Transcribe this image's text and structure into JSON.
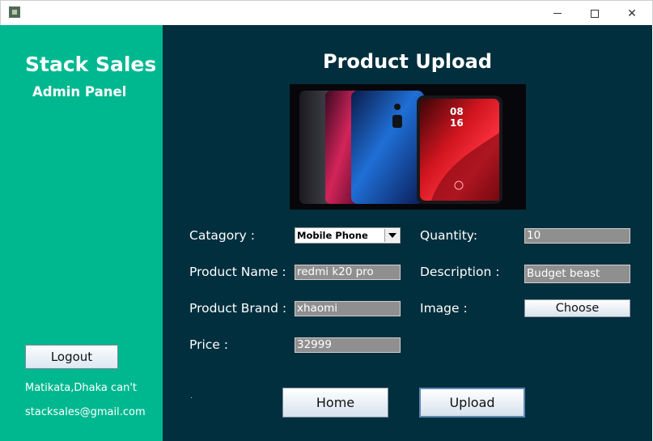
{
  "sidebar": {
    "brand": "Stack Sales",
    "subtitle": "Admin Panel",
    "logout_label": "Logout",
    "footer_address": "Matikata,Dhaka can't",
    "footer_email": "stacksales@gmail.com"
  },
  "main": {
    "title": "Product Upload",
    "form": {
      "category_label": "Catagory  :",
      "category_value": "Mobile Phone",
      "product_name_label": "Product  Name :",
      "product_name_value": "redmi k20 pro",
      "product_brand_label": "Product  Brand :",
      "product_brand_value": "xhaomi",
      "price_label": "Price :",
      "price_value": "32999",
      "quantity_label": "Quantity:",
      "quantity_value": "10",
      "description_label": "Description :",
      "description_value": "Budget beast",
      "image_label": "Image :",
      "choose_label": "Choose"
    },
    "home_label": "Home",
    "upload_label": "Upload",
    "image_clock": [
      "08",
      "16"
    ]
  },
  "colors": {
    "sidebar_bg": "#00b88f",
    "main_bg": "#022f3e",
    "field_bg": "#8f8f8f"
  },
  "icons": {
    "app": "app-icon",
    "dropdown": "chevron-down-icon"
  }
}
